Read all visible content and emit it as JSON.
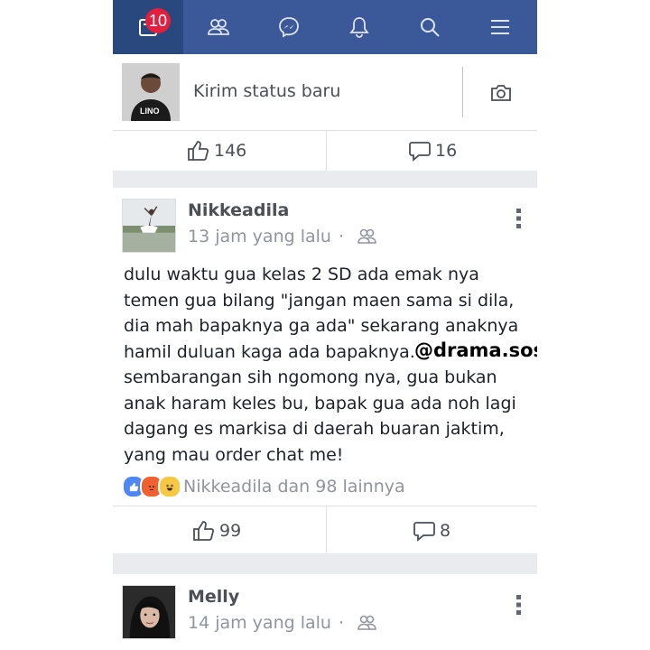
{
  "navbar": {
    "notification_badge": "10",
    "items": [
      {
        "icon": "news-feed-icon"
      },
      {
        "icon": "friends-icon"
      },
      {
        "icon": "messenger-icon"
      },
      {
        "icon": "bell-icon"
      },
      {
        "icon": "search-icon"
      },
      {
        "icon": "menu-icon"
      }
    ],
    "color": "#3b5998",
    "active_color": "#29487d"
  },
  "composer": {
    "placeholder": "Kirim status baru",
    "avatar_caption": "LINO"
  },
  "previous_post_stats": {
    "likes": "146",
    "comments": "16"
  },
  "posts": [
    {
      "author": "Nikkeadila",
      "time": "13 jam yang lalu",
      "dot": "·",
      "text": "dulu waktu gua kelas 2 SD ada emak nya\ntemen gua bilang \"jangan maen sama si dila,\ndia mah bapaknya ga ada\" sekarang anaknya\nhamil duluan kaga ada bapaknya.\nsembarangan sih ngomong nya, gua bukan\nanak haram keles bu, bapak gua ada noh lagi\ndagang es markisa di daerah buaran jaktim,\nyang mau order chat me!",
      "reactions_text": "Nikkeadila dan 98 lainnya",
      "likes": "99",
      "comments": "8"
    },
    {
      "author": "Melly",
      "time": "14 jam yang lalu",
      "dot": "·"
    }
  ],
  "watermark": "@drama.sosialmedia"
}
